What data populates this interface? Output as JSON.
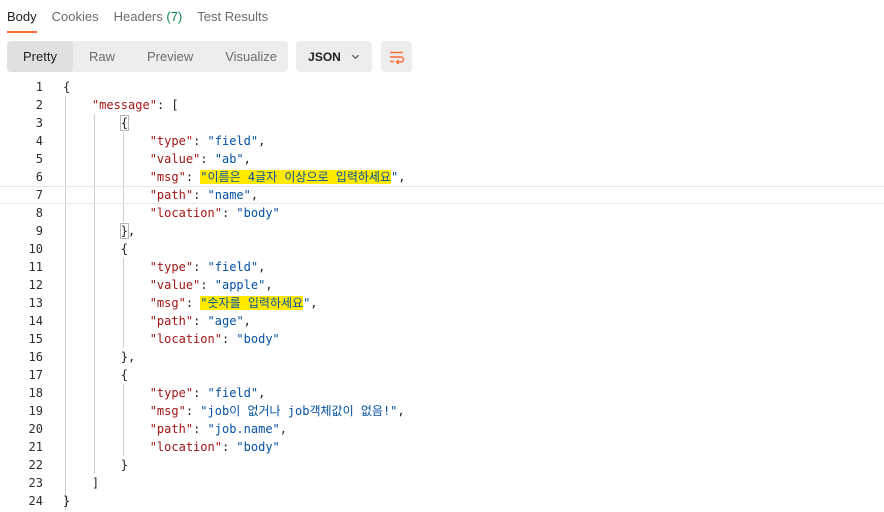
{
  "tabs": [
    {
      "label": "Body"
    },
    {
      "label": "Cookies"
    },
    {
      "label": "Headers",
      "count": "(7)"
    },
    {
      "label": "Test Results"
    }
  ],
  "view_modes": [
    "Pretty",
    "Raw",
    "Preview",
    "Visualize"
  ],
  "format": "JSON",
  "icons": {
    "format_dropdown": "chevron-down-icon",
    "wrap": "wrap-lines-icon"
  },
  "colors": {
    "accent": "#ff6c37",
    "highlight": "#ffea00",
    "key": "#a31515",
    "string": "#0451a5"
  },
  "response": {
    "line_numbers": [
      "1",
      "2",
      "3",
      "4",
      "5",
      "6",
      "7",
      "8",
      "9",
      "10",
      "11",
      "12",
      "13",
      "14",
      "15",
      "16",
      "17",
      "18",
      "19",
      "20",
      "21",
      "22",
      "23",
      "24"
    ],
    "errors": [
      {
        "type": "field",
        "value": "ab",
        "msg": "이름은 4글자 이상으로 입력하세요",
        "path": "name",
        "location": "body"
      },
      {
        "type": "field",
        "value": "apple",
        "msg": "숫자를 입력하세요",
        "path": "age",
        "location": "body"
      },
      {
        "type": "field",
        "msg": "job이 없거나 job객체값이 없음!",
        "path": "job.name",
        "location": "body"
      }
    ]
  }
}
